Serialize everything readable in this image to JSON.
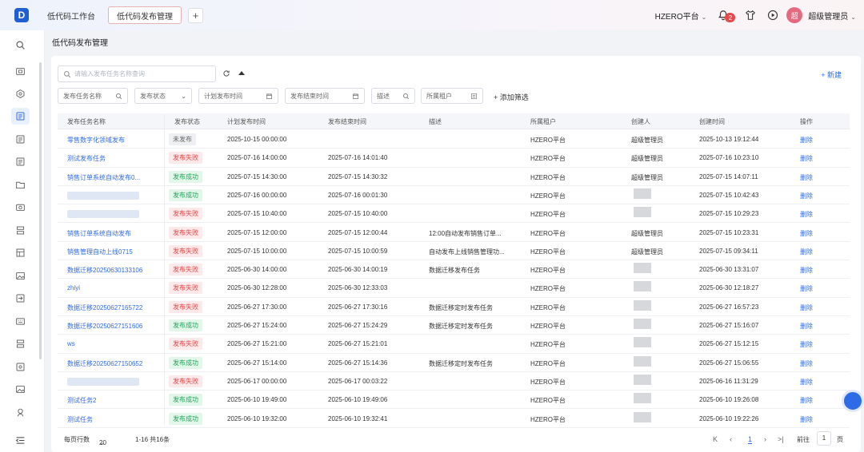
{
  "topbar": {
    "logo": "D",
    "tabs": [
      "低代码工作台",
      "低代码发布管理"
    ],
    "platform": "HZERO平台",
    "notification_count": "2",
    "avatar_text": "超",
    "user_name": "超级管理员"
  },
  "page": {
    "title": "低代码发布管理",
    "search_placeholder": "请输入发布任务名称查询",
    "new_label": "+ 新建"
  },
  "filters": {
    "task_name": "发布任务名称",
    "status": "发布状态",
    "plan_time": "计划发布时间",
    "end_time": "发布结束时间",
    "desc": "描述",
    "tenant": "所属租户",
    "add": "添加筛选"
  },
  "table": {
    "columns": [
      "发布任务名称",
      "发布状态",
      "计划发布时间",
      "发布结束时间",
      "描述",
      "所属租户",
      "创建人",
      "创建时间",
      "操作"
    ],
    "rows": [
      {
        "name": "零售数字化领域发布",
        "status": "未发布",
        "kind": "draft",
        "plan": "2025-10-15 00:00:00",
        "end": "",
        "desc": "",
        "tenant": "HZERO平台",
        "creator": "超级管理员",
        "created": "2025-10-13 19:12:44",
        "action": "删除"
      },
      {
        "name": "测试发布任务",
        "status": "发布失败",
        "kind": "fail",
        "plan": "2025-07-16 14:00:00",
        "end": "2025-07-16 14:01:40",
        "desc": "",
        "tenant": "HZERO平台",
        "creator": "超级管理员",
        "created": "2025-07-16 10:23:10",
        "action": "删除"
      },
      {
        "name": "销售订单系统自动发布0...",
        "status": "发布成功",
        "kind": "ok",
        "plan": "2025-07-15 14:30:00",
        "end": "2025-07-15 14:30:32",
        "desc": "",
        "tenant": "HZERO平台",
        "creator": "超级管理员",
        "created": "2025-07-15 14:07:11",
        "action": "删除"
      },
      {
        "name": "",
        "status": "发布成功",
        "kind": "ok",
        "plan": "2025-07-16 00:00:00",
        "end": "2025-07-16 00:01:30",
        "desc": "",
        "tenant": "HZERO平台",
        "creator": "",
        "created": "2025-07-15 10:42:43",
        "action": "删除"
      },
      {
        "name": "",
        "status": "发布失败",
        "kind": "fail",
        "plan": "2025-07-15 10:40:00",
        "end": "2025-07-15 10:40:00",
        "desc": "",
        "tenant": "HZERO平台",
        "creator": "",
        "created": "2025-07-15 10:29:23",
        "action": "删除"
      },
      {
        "name": "销售订单系统自动发布",
        "status": "发布失败",
        "kind": "fail",
        "plan": "2025-07-15 12:00:00",
        "end": "2025-07-15 12:00:44",
        "desc": "12:00自动发布销售订单...",
        "tenant": "HZERO平台",
        "creator": "超级管理员",
        "created": "2025-07-15 10:23:31",
        "action": "删除"
      },
      {
        "name": "销售管理自动上线0715",
        "status": "发布失败",
        "kind": "fail",
        "plan": "2025-07-15 10:00:00",
        "end": "2025-07-15 10:00:59",
        "desc": "自动发布上线销售管理功...",
        "tenant": "HZERO平台",
        "creator": "超级管理员",
        "created": "2025-07-15 09:34:11",
        "action": "删除"
      },
      {
        "name": "数据迁移20250630133106",
        "status": "发布失败",
        "kind": "fail",
        "plan": "2025-06-30 14:00:00",
        "end": "2025-06-30 14:00:19",
        "desc": "数据迁移发布任务",
        "tenant": "HZERO平台",
        "creator": "",
        "created": "2025-06-30 13:31:07",
        "action": "删除"
      },
      {
        "name": "zhiyi",
        "status": "发布失败",
        "kind": "fail",
        "plan": "2025-06-30 12:28:00",
        "end": "2025-06-30 12:33:03",
        "desc": "",
        "tenant": "HZERO平台",
        "creator": "",
        "created": "2025-06-30 12:18:27",
        "action": "删除"
      },
      {
        "name": "数据迁移20250627165722",
        "status": "发布失败",
        "kind": "fail",
        "plan": "2025-06-27 17:30:00",
        "end": "2025-06-27 17:30:16",
        "desc": "数据迁移定时发布任务",
        "tenant": "HZERO平台",
        "creator": "",
        "created": "2025-06-27 16:57:23",
        "action": "删除"
      },
      {
        "name": "数据迁移20250627151606",
        "status": "发布成功",
        "kind": "ok",
        "plan": "2025-06-27 15:24:00",
        "end": "2025-06-27 15:24:29",
        "desc": "数据迁移定时发布任务",
        "tenant": "HZERO平台",
        "creator": "",
        "created": "2025-06-27 15:16:07",
        "action": "删除"
      },
      {
        "name": "ws",
        "status": "发布失败",
        "kind": "fail",
        "plan": "2025-06-27 15:21:00",
        "end": "2025-06-27 15:21:01",
        "desc": "",
        "tenant": "HZERO平台",
        "creator": "",
        "created": "2025-06-27 15:12:15",
        "action": "删除"
      },
      {
        "name": "数据迁移20250627150652",
        "status": "发布成功",
        "kind": "ok",
        "plan": "2025-06-27 15:14:00",
        "end": "2025-06-27 15:14:36",
        "desc": "数据迁移定时发布任务",
        "tenant": "HZERO平台",
        "creator": "",
        "created": "2025-06-27 15:06:55",
        "action": "删除"
      },
      {
        "name": "",
        "status": "发布失败",
        "kind": "fail",
        "plan": "2025-06-17 00:00:00",
        "end": "2025-06-17 00:03:22",
        "desc": "",
        "tenant": "HZERO平台",
        "creator": "",
        "created": "2025-06-16 11:31:29",
        "action": "删除"
      },
      {
        "name": "测试任务2",
        "status": "发布成功",
        "kind": "ok",
        "plan": "2025-06-10 19:49:00",
        "end": "2025-06-10 19:49:06",
        "desc": "",
        "tenant": "HZERO平台",
        "creator": "",
        "created": "2025-06-10 19:26:08",
        "action": "删除"
      },
      {
        "name": "测试任务",
        "status": "发布成功",
        "kind": "ok",
        "plan": "2025-06-10 19:32:00",
        "end": "2025-06-10 19:32:41",
        "desc": "",
        "tenant": "HZERO平台",
        "creator": "",
        "created": "2025-06-10 19:22:26",
        "action": "删除"
      }
    ]
  },
  "pagination": {
    "page_size_label": "每页行数",
    "page_size": "20",
    "range": "1-16 共16条",
    "current": "1",
    "goto_label": "前往",
    "goto_value": "1",
    "page_unit": "页"
  },
  "colors": {
    "primary": "#2e6be6",
    "fail": "#e64545",
    "success": "#22a55a"
  }
}
